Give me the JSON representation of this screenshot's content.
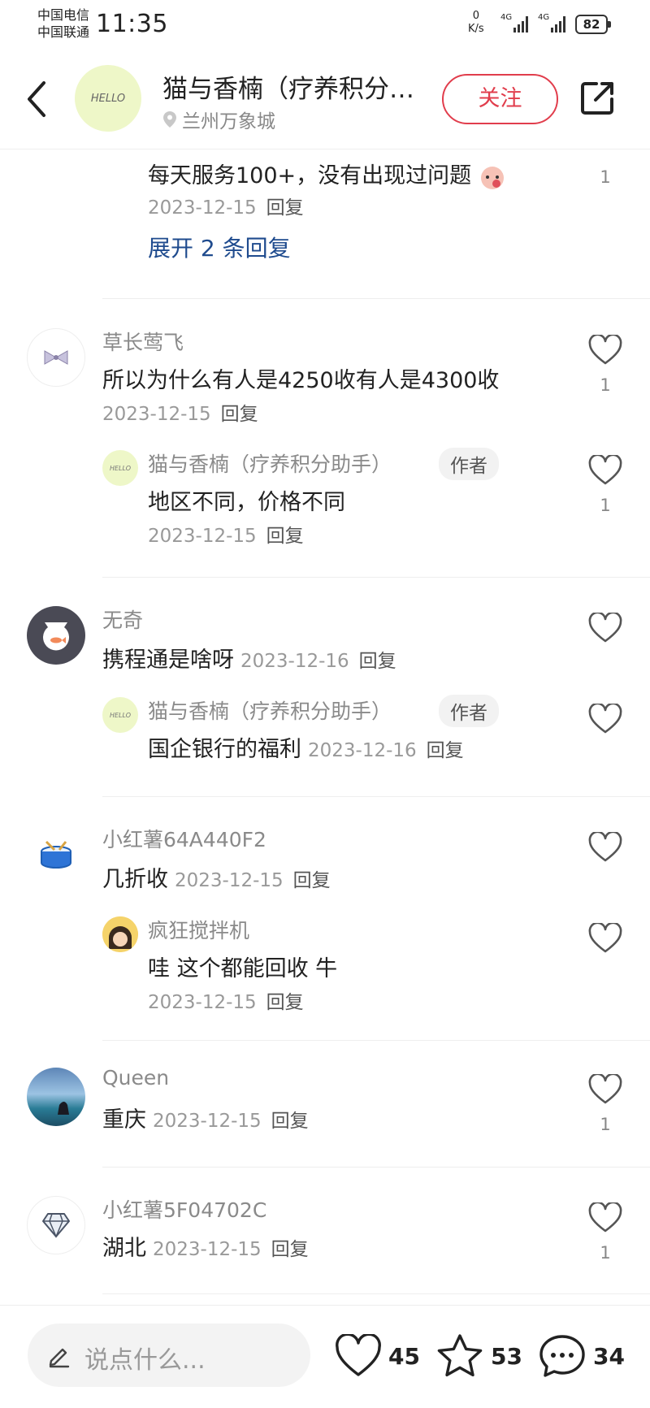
{
  "status_bar": {
    "carrier_1": "中国电信",
    "carrier_2": "中国联通",
    "time": "11:35",
    "net_speed_value": "0",
    "net_speed_unit": "K/s",
    "signal_1_label": "4G",
    "signal_2_label": "4G",
    "battery": "82"
  },
  "header": {
    "author_name": "猫与香楠（疗养积分助手）",
    "location": "兰州万象城",
    "follow_label": "关注",
    "avatar_text": "HELLO"
  },
  "comments": {
    "partial": {
      "text": "每天服务100+，没有出现过问题",
      "date": "2023-12-15",
      "reply_label": "回复",
      "likes": "1",
      "expand_label": "展开 2 条回复"
    },
    "c1": {
      "name": "草长莺飞",
      "text": "所以为什么有人是4250收有人是4300收",
      "date": "2023-12-15",
      "reply_label": "回复",
      "likes": "1",
      "reply": {
        "name": "猫与香楠（疗养积分助手）",
        "tag": "作者",
        "text": "地区不同，价格不同",
        "date": "2023-12-15",
        "reply_label": "回复",
        "likes": "1"
      }
    },
    "c2": {
      "name": "无奇",
      "text": "携程通是啥呀",
      "date": "2023-12-16",
      "reply_label": "回复",
      "reply": {
        "name": "猫与香楠（疗养积分助手）",
        "tag": "作者",
        "text": "国企银行的福利",
        "date": "2023-12-16",
        "reply_label": "回复"
      }
    },
    "c3": {
      "name": "小红薯64A440F2",
      "text": "几折收",
      "date": "2023-12-15",
      "reply_label": "回复",
      "reply": {
        "name": "疯狂搅拌机",
        "text": "哇 这个都能回收 牛",
        "date": "2023-12-15",
        "reply_label": "回复"
      }
    },
    "c4": {
      "name": "Queen",
      "text": "重庆",
      "date": "2023-12-15",
      "reply_label": "回复",
      "likes": "1"
    },
    "c5": {
      "name": "小红薯5F04702C",
      "text": "湖北",
      "date": "2023-12-15",
      "reply_label": "回复",
      "likes": "1"
    }
  },
  "bottom_bar": {
    "placeholder": "说点什么...",
    "likes": "45",
    "stars": "53",
    "comments": "34"
  },
  "colors": {
    "accent_red": "#e13d4c",
    "link_blue": "#1f4b8e"
  }
}
